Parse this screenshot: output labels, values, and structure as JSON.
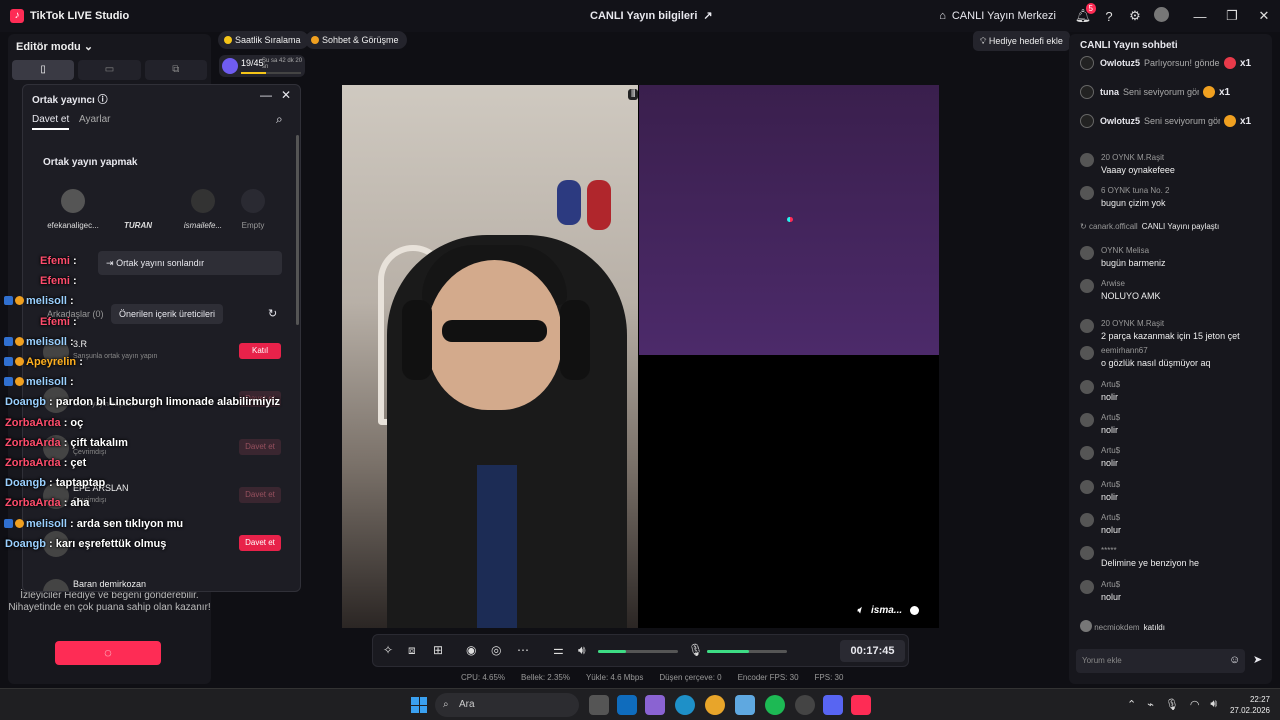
{
  "window": {
    "app_title": "TikTok LIVE Studio",
    "center_title": "CANLI Yayın bilgileri",
    "live_center": "CANLI Yayın Merkezi",
    "notifications_count": "5"
  },
  "left": {
    "editor_mode": "Editör modu",
    "note": "İzleyiciler Hediye ve beğeni gönderebilir. Nihayetinde en çok puana sahip olan kazanır!"
  },
  "chips": {
    "hourly_ranking": "Saatlik Sıralama",
    "chat_meet": "Sohbet & Görüşme",
    "progress_text": "19/45",
    "progress_sub": "Şu sa 42 dk 20 sn",
    "progress_fraction": 0.42,
    "gift_goal": "Hediye hedefi ekle"
  },
  "cohost": {
    "title": "Ortak yayıncı",
    "tab_invite": "Davet et",
    "tab_settings": "Ayarlar",
    "section_title": "Ortak yayın yapmak",
    "slots": [
      "efekanaligec...",
      "TURAN",
      "ismailefe...",
      "Empty"
    ],
    "end_button": "Ortak yayını sonlandır",
    "friends_tab": "Arkadaşlar (0)",
    "suggested_tab": "Önerilen içerik üreticileri",
    "candidates": [
      {
        "name": "3.R",
        "sub": "Sanşunla ortak yayın yapın",
        "button": "Katıl",
        "style": "red"
      },
      {
        "name": "",
        "sub": "Ortak yayın başlatın",
        "button": "Davet et",
        "style": "dim"
      },
      {
        "name": "",
        "sub": "Çevrimdışı",
        "button": "Davet et",
        "style": "dim"
      },
      {
        "name": "EFE ARSLAN",
        "sub": "Çevrimdışı",
        "button": "Davet et",
        "style": "dim"
      },
      {
        "name": "",
        "sub": "",
        "button": "Davet et",
        "style": "red"
      },
      {
        "name": "Baran demirkozan",
        "sub": "",
        "button": "",
        "style": "dim"
      }
    ]
  },
  "overlay_chat": [
    {
      "user": "Efemi",
      "text": ":",
      "color": "#ff4d6d"
    },
    {
      "user": "Efemi",
      "text": ":",
      "color": "#ff4d6d"
    },
    {
      "user": "melisoll",
      "text": ":",
      "color": "#9ad0ff"
    },
    {
      "user": "Efemi",
      "text": ":",
      "color": "#ff4d6d"
    },
    {
      "user": "melisoll",
      "text": ":",
      "color": "#9ad0ff"
    },
    {
      "user": "Apeyrelin",
      "text": ":",
      "color": "#ffb020"
    },
    {
      "user": "melisoll",
      "text": ":",
      "color": "#9ad0ff"
    },
    {
      "user": "Doangb",
      "text": ": pardon bi Lincburgh limonade alabilirmiyiz",
      "color": "#9ad0ff"
    },
    {
      "user": "ZorbaArda",
      "text": ": oç",
      "color": "#ff4d6d"
    },
    {
      "user": "ZorbaArda",
      "text": ": çift takalım",
      "color": "#ff4d6d"
    },
    {
      "user": "ZorbaArda",
      "text": ": çet",
      "color": "#ff4d6d"
    },
    {
      "user": "Doangb",
      "text": ": taptaptap",
      "color": "#9ad0ff"
    },
    {
      "user": "ZorbaArda",
      "text": ": aha",
      "color": "#ff4d6d"
    },
    {
      "user": "melisoll",
      "text": ": arda sen tıklıyon mu",
      "color": "#9ad0ff"
    },
    {
      "user": "Doangb",
      "text": ": karı eşrefettük olmuş",
      "color": "#9ad0ff"
    }
  ],
  "video": {
    "guest_label": "isma..."
  },
  "controls": {
    "timer": "00:17:45",
    "speaker_level": 0.35,
    "mic_level": 0.52
  },
  "stats": {
    "cpu": "CPU: 4.65%",
    "memory": "Bellek: 2.35%",
    "upload": "Yükle: 4.6 Mbps",
    "dropped": "Düşen çerçeve: 0",
    "encoder_fps": "Encoder FPS: 30",
    "fps": "FPS: 30"
  },
  "chat": {
    "title": "CANLI Yayın sohbeti",
    "gifts": [
      {
        "user": "Owlotuz5",
        "text": "Parlıyorsun! gönder",
        "count": "x1",
        "icon": "red"
      },
      {
        "user": "tuna",
        "text": "Seni seviyorum gönderildi",
        "count": "x1",
        "icon": "orange"
      },
      {
        "user": "Owlotuz5",
        "text": "Seni seviyorum gönderildi",
        "count": "x1",
        "icon": "orange"
      }
    ],
    "messages": [
      {
        "head": "20 OYNK M.Raşit",
        "text": "Vaaay oynakefeee"
      },
      {
        "head": "6 OYNK tuna No. 2",
        "text": "bugun çizim yok"
      },
      {
        "head": "OYNK Melisa",
        "text": "bugün barmeniz"
      },
      {
        "head": "Arwise",
        "text": "NOLUYO AMK"
      },
      {
        "head": "20 OYNK M.Raşit",
        "text": "2 parça kazanmak için 15 jeton çet"
      },
      {
        "head": "eemirhann67",
        "text": "o gözlük nasıl düşmüyor aq"
      },
      {
        "head": "Artu$",
        "text": "nolir"
      },
      {
        "head": "Artu$",
        "text": "nolir"
      },
      {
        "head": "Artu$",
        "text": "nolir"
      },
      {
        "head": "Artu$",
        "text": "nolir"
      },
      {
        "head": "Artu$",
        "text": "nolur"
      },
      {
        "head": "*****",
        "text": "Delimine ye benziyon he"
      },
      {
        "head": "Artu$",
        "text": "nolur"
      }
    ],
    "share_user": "canark.officall",
    "share_text": "CANLI Yayını paylaştı",
    "joined_user": "necmiokdem",
    "joined_text": "katıldı",
    "input_placeholder": "Yorum ekle"
  },
  "taskbar": {
    "search_placeholder": "Ara",
    "time": "22:27",
    "date": "27.02.2026"
  }
}
